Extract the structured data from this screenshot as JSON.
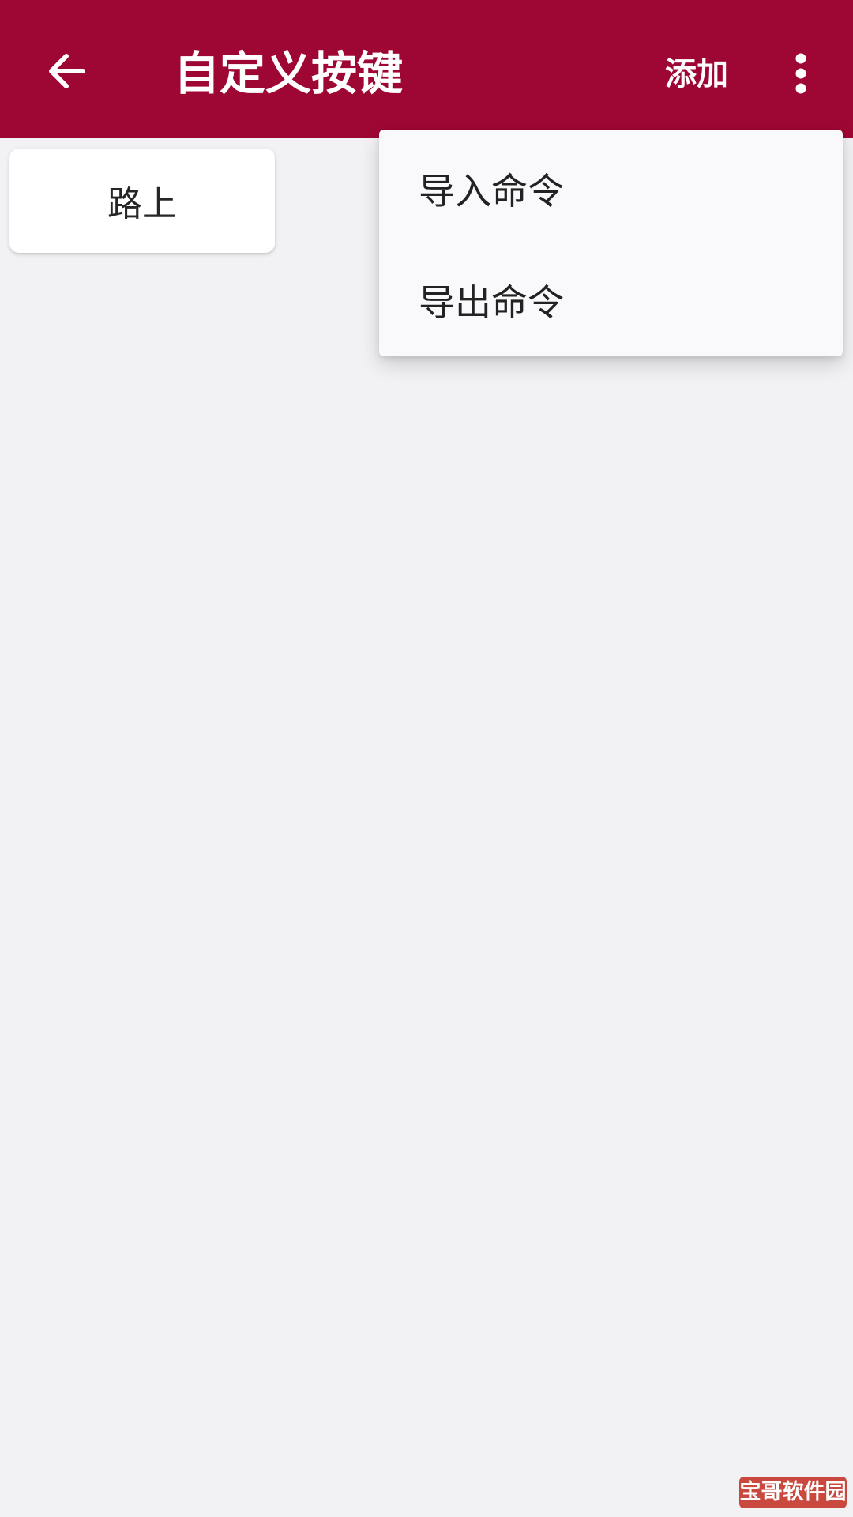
{
  "app_bar": {
    "back_icon": "arrow-left-icon",
    "title": "自定义按键",
    "add_label": "添加",
    "overflow_icon": "more-vertical-icon",
    "color": "#9e0734"
  },
  "keys": [
    {
      "label": "路上"
    }
  ],
  "menu": {
    "items": [
      {
        "label": "导入命令"
      },
      {
        "label": "导出命令"
      }
    ]
  },
  "watermark": {
    "text": "宝哥软件园"
  }
}
